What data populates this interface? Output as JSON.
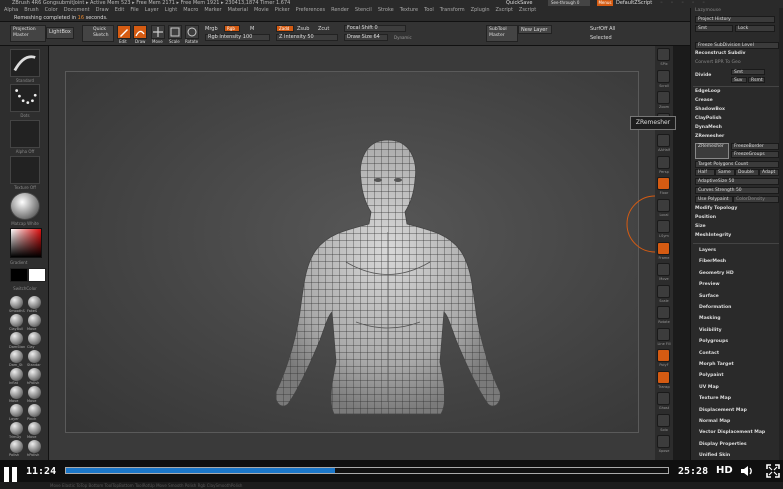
{
  "titlebar": {
    "text": "ZBrush 4R6    GongsubmitJoint      ▸ Active Mem 523 ▸ Free Mem 2171 ▸ Free Mem 1921 ▸ 230413,1874 Timer 1.674"
  },
  "menubar": [
    "Alpha",
    "Brush",
    "Color",
    "Document",
    "Draw",
    "Edit",
    "File",
    "Layer",
    "Light",
    "Macro",
    "Marker",
    "Material",
    "Movie",
    "Picker",
    "Preferences",
    "Render",
    "Stencil",
    "Stroke",
    "Texture",
    "Tool",
    "Transform",
    "Zplugin",
    "Zscript",
    "Zscript"
  ],
  "status": {
    "prefix": "Remeshing completed in",
    "seconds": "16",
    "suffix": "seconds."
  },
  "top_right": {
    "quicksave": "QuickSave",
    "seethrough": "See-through 0",
    "menus": "Menus",
    "defscript": "DefaultZScript"
  },
  "toolbar": {
    "projection_master": "Projection\nMaster",
    "lightbox": "LightBox",
    "quick_sketch": "Quick\nSketch",
    "edit": "Edit",
    "draw": "Draw",
    "move": "Move",
    "scale": "Scale",
    "rotate": "Rotate",
    "mrgb": "Mrgb",
    "rgb": "Rgb",
    "m": "M",
    "rgb_intensity": "Rgb Intensity 100",
    "zadd": "Zadd",
    "zsub": "Zsub",
    "zcut": "Zcut",
    "z_intensity": "Z Intensity 50",
    "focal_shift": "Focal Shift 0",
    "draw_size": "Draw Size 64",
    "dynamic": "Dynamic",
    "subtool_master": "SubTool\nMaster",
    "new_layer": "New Layer",
    "surf_off_all": "SurfOff All",
    "selected": "Selected"
  },
  "left_tray": {
    "thumbs": [
      "Standard",
      "Dots",
      "Alpha Off",
      "Texture Off",
      "Matcap White"
    ],
    "gradient": "Gradient",
    "switch_color": "SwitchColor",
    "brushes": [
      "SmoothS",
      "FakeS",
      "ClayBuil",
      "Move",
      "DamStan",
      "Clay",
      "Dam_St",
      "Standar",
      "Inflat",
      "hPolish",
      "Move",
      "Move",
      "Layer",
      "Pinch",
      "TrimDy",
      "Move",
      "Polish",
      "hPolish"
    ]
  },
  "right_icons": [
    "SPix",
    "Scroll",
    "Zoom",
    "Actual",
    "AAHalf",
    "Persp",
    "Floor",
    "Local",
    "LSym",
    "Frame",
    "Move",
    "Scale",
    "Rotate",
    "Line Fill",
    "PolyF",
    "Transp",
    "Ghost",
    "Solo",
    "Xpose"
  ],
  "tooltip": "ZRemesher",
  "right_panel": {
    "top": [
      "Lazymouse",
      "Project History",
      "Smt",
      "Lock",
      "Freeze SubDivision Level",
      "Reconstruct Subdiv",
      "Convert BPR To Geo",
      "Divide",
      "Suv",
      "Rsmt",
      "EdgeLoop",
      "Crease",
      "ShadowBox",
      "ClayPolish",
      "DynaMesh",
      "ZRemesher"
    ],
    "zremesher": [
      "ZRemesher",
      "FreezeBorder",
      "FreezeGroups",
      "Target Polygons Count",
      "Half",
      "Same",
      "Double",
      "Adapt",
      "AdaptiveSize 50",
      "Curves Strength 50",
      "Use Polypaint",
      "ColorDensity",
      "Modify Topology",
      "Position",
      "Size",
      "MeshIntegrity"
    ],
    "sections": [
      "Layers",
      "FiberMesh",
      "Geometry HD",
      "Preview",
      "Surface",
      "Deformation",
      "Masking",
      "Visibility",
      "Polygroups",
      "Contact",
      "Morph Target",
      "Polypaint",
      "UV Map",
      "Texture Map",
      "Displacement Map",
      "Normal Map",
      "Vector Displacement Map",
      "Display Properties",
      "Unified Skin"
    ]
  },
  "player": {
    "current_time": "11:24",
    "duration": "25:28",
    "hd_label": "HD",
    "progress": 0.447
  },
  "bottom_strip": "Move Elastic    ToTop Bottom    ToolTopBottom    ToolRotUp    Move Smooth    Polish Rgb    ClaySmoothPolish"
}
